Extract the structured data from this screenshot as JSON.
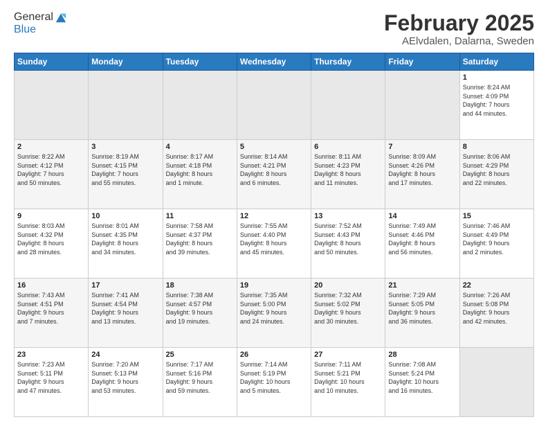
{
  "logo": {
    "line1": "General",
    "line2": "Blue"
  },
  "title": "February 2025",
  "subtitle": "AElvdalen, Dalarna, Sweden",
  "weekdays": [
    "Sunday",
    "Monday",
    "Tuesday",
    "Wednesday",
    "Thursday",
    "Friday",
    "Saturday"
  ],
  "weeks": [
    [
      {
        "day": "",
        "info": ""
      },
      {
        "day": "",
        "info": ""
      },
      {
        "day": "",
        "info": ""
      },
      {
        "day": "",
        "info": ""
      },
      {
        "day": "",
        "info": ""
      },
      {
        "day": "",
        "info": ""
      },
      {
        "day": "1",
        "info": "Sunrise: 8:24 AM\nSunset: 4:09 PM\nDaylight: 7 hours\nand 44 minutes."
      }
    ],
    [
      {
        "day": "2",
        "info": "Sunrise: 8:22 AM\nSunset: 4:12 PM\nDaylight: 7 hours\nand 50 minutes."
      },
      {
        "day": "3",
        "info": "Sunrise: 8:19 AM\nSunset: 4:15 PM\nDaylight: 7 hours\nand 55 minutes."
      },
      {
        "day": "4",
        "info": "Sunrise: 8:17 AM\nSunset: 4:18 PM\nDaylight: 8 hours\nand 1 minute."
      },
      {
        "day": "5",
        "info": "Sunrise: 8:14 AM\nSunset: 4:21 PM\nDaylight: 8 hours\nand 6 minutes."
      },
      {
        "day": "6",
        "info": "Sunrise: 8:11 AM\nSunset: 4:23 PM\nDaylight: 8 hours\nand 11 minutes."
      },
      {
        "day": "7",
        "info": "Sunrise: 8:09 AM\nSunset: 4:26 PM\nDaylight: 8 hours\nand 17 minutes."
      },
      {
        "day": "8",
        "info": "Sunrise: 8:06 AM\nSunset: 4:29 PM\nDaylight: 8 hours\nand 22 minutes."
      }
    ],
    [
      {
        "day": "9",
        "info": "Sunrise: 8:03 AM\nSunset: 4:32 PM\nDaylight: 8 hours\nand 28 minutes."
      },
      {
        "day": "10",
        "info": "Sunrise: 8:01 AM\nSunset: 4:35 PM\nDaylight: 8 hours\nand 34 minutes."
      },
      {
        "day": "11",
        "info": "Sunrise: 7:58 AM\nSunset: 4:37 PM\nDaylight: 8 hours\nand 39 minutes."
      },
      {
        "day": "12",
        "info": "Sunrise: 7:55 AM\nSunset: 4:40 PM\nDaylight: 8 hours\nand 45 minutes."
      },
      {
        "day": "13",
        "info": "Sunrise: 7:52 AM\nSunset: 4:43 PM\nDaylight: 8 hours\nand 50 minutes."
      },
      {
        "day": "14",
        "info": "Sunrise: 7:49 AM\nSunset: 4:46 PM\nDaylight: 8 hours\nand 56 minutes."
      },
      {
        "day": "15",
        "info": "Sunrise: 7:46 AM\nSunset: 4:49 PM\nDaylight: 9 hours\nand 2 minutes."
      }
    ],
    [
      {
        "day": "16",
        "info": "Sunrise: 7:43 AM\nSunset: 4:51 PM\nDaylight: 9 hours\nand 7 minutes."
      },
      {
        "day": "17",
        "info": "Sunrise: 7:41 AM\nSunset: 4:54 PM\nDaylight: 9 hours\nand 13 minutes."
      },
      {
        "day": "18",
        "info": "Sunrise: 7:38 AM\nSunset: 4:57 PM\nDaylight: 9 hours\nand 19 minutes."
      },
      {
        "day": "19",
        "info": "Sunrise: 7:35 AM\nSunset: 5:00 PM\nDaylight: 9 hours\nand 24 minutes."
      },
      {
        "day": "20",
        "info": "Sunrise: 7:32 AM\nSunset: 5:02 PM\nDaylight: 9 hours\nand 30 minutes."
      },
      {
        "day": "21",
        "info": "Sunrise: 7:29 AM\nSunset: 5:05 PM\nDaylight: 9 hours\nand 36 minutes."
      },
      {
        "day": "22",
        "info": "Sunrise: 7:26 AM\nSunset: 5:08 PM\nDaylight: 9 hours\nand 42 minutes."
      }
    ],
    [
      {
        "day": "23",
        "info": "Sunrise: 7:23 AM\nSunset: 5:11 PM\nDaylight: 9 hours\nand 47 minutes."
      },
      {
        "day": "24",
        "info": "Sunrise: 7:20 AM\nSunset: 5:13 PM\nDaylight: 9 hours\nand 53 minutes."
      },
      {
        "day": "25",
        "info": "Sunrise: 7:17 AM\nSunset: 5:16 PM\nDaylight: 9 hours\nand 59 minutes."
      },
      {
        "day": "26",
        "info": "Sunrise: 7:14 AM\nSunset: 5:19 PM\nDaylight: 10 hours\nand 5 minutes."
      },
      {
        "day": "27",
        "info": "Sunrise: 7:11 AM\nSunset: 5:21 PM\nDaylight: 10 hours\nand 10 minutes."
      },
      {
        "day": "28",
        "info": "Sunrise: 7:08 AM\nSunset: 5:24 PM\nDaylight: 10 hours\nand 16 minutes."
      },
      {
        "day": "",
        "info": ""
      }
    ]
  ]
}
